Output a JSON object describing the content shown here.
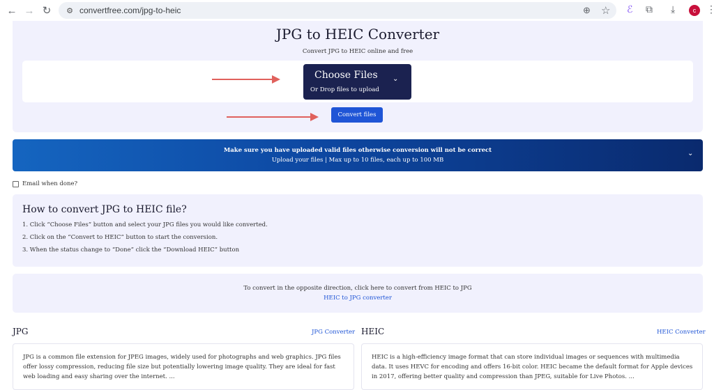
{
  "browser": {
    "url": "convertfree.com/jpg-to-heic",
    "icons": [
      "back-arrow-icon",
      "forward-arrow-icon",
      "reload-icon",
      "site-info-icon",
      "zoom-icon",
      "star-icon",
      "extension-icon",
      "puzzle-icon",
      "download-icon",
      "menu-icon"
    ],
    "avatar_letter": "c",
    "avatar_color": "#c8103b"
  },
  "hero": {
    "title": "JPG to HEIC Converter",
    "subtitle": "Convert JPG to HEIC online and free",
    "choose_files_label": "Choose Files",
    "drop_hint": "Or Drop files to upload",
    "convert_label": "Convert files"
  },
  "notice": {
    "line1": "Make sure you have uploaded valid files otherwise conversion will not be correct",
    "line2": "Upload your files | Max up to 10 files, each up to 100 MB"
  },
  "email": {
    "label": "Email when done?"
  },
  "howto": {
    "title": "How to convert JPG to HEIC file?",
    "steps": [
      "1. Click “Choose Files” button and select your JPG files you would like converted.",
      "2. Click on the “Convert to HEIC” button to start the conversion.",
      "3. When the status change to “Done” click the “Download HEIC” button"
    ]
  },
  "opposite": {
    "text": "To convert in the opposite direction, click here to convert from HEIC to JPG",
    "link": "HEIC to JPG converter"
  },
  "formats": [
    {
      "title": "JPG",
      "link": "JPG Converter",
      "lines": [
        "JPG is a common file extension for JPEG images, widely used for photographs and web graphics. JPG files",
        "offer lossy compression, reducing file size but potentially lowering image quality. They are ideal for fast",
        "web loading and easy sharing over the internet. ..."
      ]
    },
    {
      "title": "HEIC",
      "link": "HEIC Converter",
      "lines": [
        "HEIC is a high-efficiency image format that can store individual images or sequences with multimedia",
        "data. It uses HEVC for encoding and offers 16-bit color. HEIC became the default format for Apple devices",
        "in 2017, offering better quality and compression than JPEG, suitable for Live Photos. ..."
      ]
    }
  ],
  "colors": {
    "accent": "#1f55d6",
    "choose_button": "#1b2250",
    "panel_bg": "#f1f1fd",
    "arrow": "#e0615c"
  }
}
